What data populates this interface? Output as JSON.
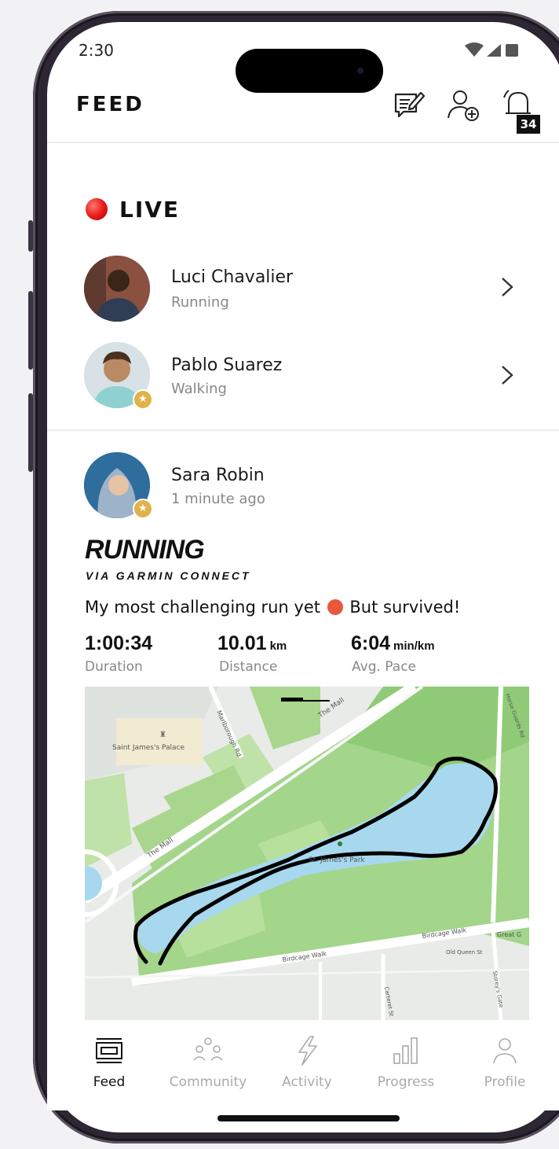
{
  "status_bar": {
    "time": "2:30",
    "icons": "signal-wifi-battery"
  },
  "header": {
    "title": "FEED",
    "icons": [
      "compose-icon",
      "add-friend-icon",
      "notifications-icon"
    ],
    "notification_count": "34"
  },
  "live": {
    "label": "LIVE",
    "people": [
      {
        "name": "Luci Chavalier",
        "activity": "Running",
        "starred": false
      },
      {
        "name": "Pablo Suarez",
        "activity": "Walking",
        "starred": true
      }
    ]
  },
  "post": {
    "author": "Sara Robin",
    "time_ago": "1 minute ago",
    "activity_type": "RUNNING",
    "source": "VIA GARMIN CONNECT",
    "caption_before": "My most challenging run yet",
    "caption_after": "But survived!",
    "stats": [
      {
        "value": "1:00:34",
        "unit": "",
        "label": "Duration"
      },
      {
        "value": "10.01",
        "unit": "km",
        "label": "Distance"
      },
      {
        "value": "6:04",
        "unit": "min/km",
        "label": "Avg. Pace"
      }
    ],
    "map": {
      "labels": {
        "palace": "Saint James's Palace",
        "park": "St. James's Park",
        "mall_top": "The Mall",
        "mall_left": "The Mall",
        "marlborough": "Marlborough Rd",
        "birdcage_left": "Birdcage Walk",
        "birdcage_right": "Birdcage Walk",
        "great_george": "Great G",
        "old_queen": "Old Queen St",
        "horse_guards": "Horse Guards Rd",
        "storeys_gate": "Storey's Gate",
        "carteret": "Carteret St"
      }
    }
  },
  "tabs": [
    {
      "label": "Feed",
      "icon": "feed-icon",
      "active": true
    },
    {
      "label": "Community",
      "icon": "community-icon",
      "active": false
    },
    {
      "label": "Activity",
      "icon": "lightning-icon",
      "active": false
    },
    {
      "label": "Progress",
      "icon": "bar-chart-icon",
      "active": false
    },
    {
      "label": "Profile",
      "icon": "person-icon",
      "active": false
    }
  ],
  "colors": {
    "live_red": "#e81c1c",
    "park_green": "#9fd08a",
    "water_blue": "#a8d8ee",
    "route": "#000000",
    "badge_gold": "#e0b24a"
  }
}
